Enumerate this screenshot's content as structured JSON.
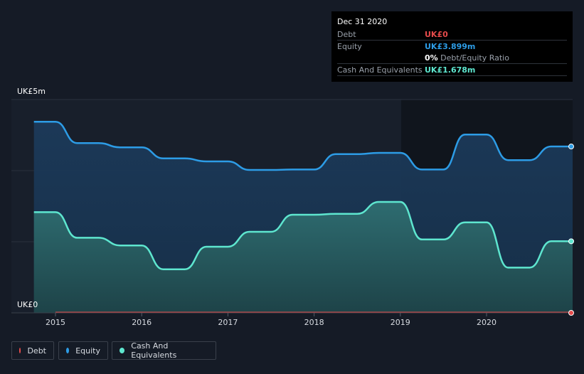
{
  "tooltip": {
    "date": "Dec 31 2020",
    "rows": [
      {
        "label": "Debt",
        "value": "UK£0",
        "color": "#e64b4b"
      },
      {
        "label": "Equity",
        "value": "UK£3.899m",
        "color": "#2d9ce6"
      },
      {
        "label": "",
        "value": "0%",
        "extra": " Debt/Equity Ratio",
        "color": "#ffffff"
      },
      {
        "label": "Cash And Equivalents",
        "value": "UK£1.678m",
        "color": "#5ee6cf"
      }
    ]
  },
  "legend": [
    {
      "label": "Debt",
      "color": "#e64b4b"
    },
    {
      "label": "Equity",
      "color": "#2d9ce6"
    },
    {
      "label": "Cash And Equivalents",
      "color": "#5ee6cf"
    }
  ],
  "chart_data": {
    "type": "area",
    "ylim": [
      0,
      5
    ],
    "y_tick_labels": [
      "UK£0",
      "UK£5m"
    ],
    "x_tick_labels": [
      "2015",
      "2016",
      "2017",
      "2018",
      "2019",
      "2020"
    ],
    "x_ticks": [
      2015,
      2016,
      2017,
      2018,
      2019,
      2020
    ],
    "xlim": [
      2014.5,
      2021.0
    ],
    "grid": true,
    "legend_position": "bottom-left",
    "series": [
      {
        "name": "Equity",
        "color": "#2d9ce6",
        "x": [
          2014.75,
          2015.0,
          2015.25,
          2015.5,
          2015.75,
          2016.0,
          2016.25,
          2016.5,
          2016.75,
          2017.0,
          2017.25,
          2017.5,
          2017.75,
          2018.0,
          2018.25,
          2018.5,
          2018.75,
          2019.0,
          2019.25,
          2019.5,
          2019.75,
          2020.0,
          2020.25,
          2020.5,
          2020.75,
          2021.0
        ],
        "values": [
          4.48,
          4.48,
          3.98,
          3.98,
          3.88,
          3.88,
          3.62,
          3.62,
          3.55,
          3.55,
          3.35,
          3.35,
          3.36,
          3.36,
          3.72,
          3.72,
          3.75,
          3.75,
          3.36,
          3.36,
          4.18,
          4.18,
          3.58,
          3.58,
          3.9,
          3.899
        ]
      },
      {
        "name": "Cash And Equivalents",
        "color": "#5ee6cf",
        "x": [
          2014.75,
          2015.0,
          2015.25,
          2015.5,
          2015.75,
          2016.0,
          2016.25,
          2016.5,
          2016.75,
          2017.0,
          2017.25,
          2017.5,
          2017.75,
          2018.0,
          2018.25,
          2018.5,
          2018.75,
          2019.0,
          2019.25,
          2019.5,
          2019.75,
          2020.0,
          2020.25,
          2020.5,
          2020.75,
          2021.0
        ],
        "values": [
          2.36,
          2.36,
          1.76,
          1.76,
          1.58,
          1.58,
          1.02,
          1.02,
          1.55,
          1.55,
          1.9,
          1.9,
          2.3,
          2.3,
          2.32,
          2.32,
          2.6,
          2.6,
          1.72,
          1.72,
          2.12,
          2.12,
          1.06,
          1.06,
          1.68,
          1.678
        ]
      },
      {
        "name": "Debt",
        "color": "#e64b4b",
        "x": [
          2015.0,
          2021.0
        ],
        "values": [
          0,
          0
        ]
      }
    ]
  }
}
